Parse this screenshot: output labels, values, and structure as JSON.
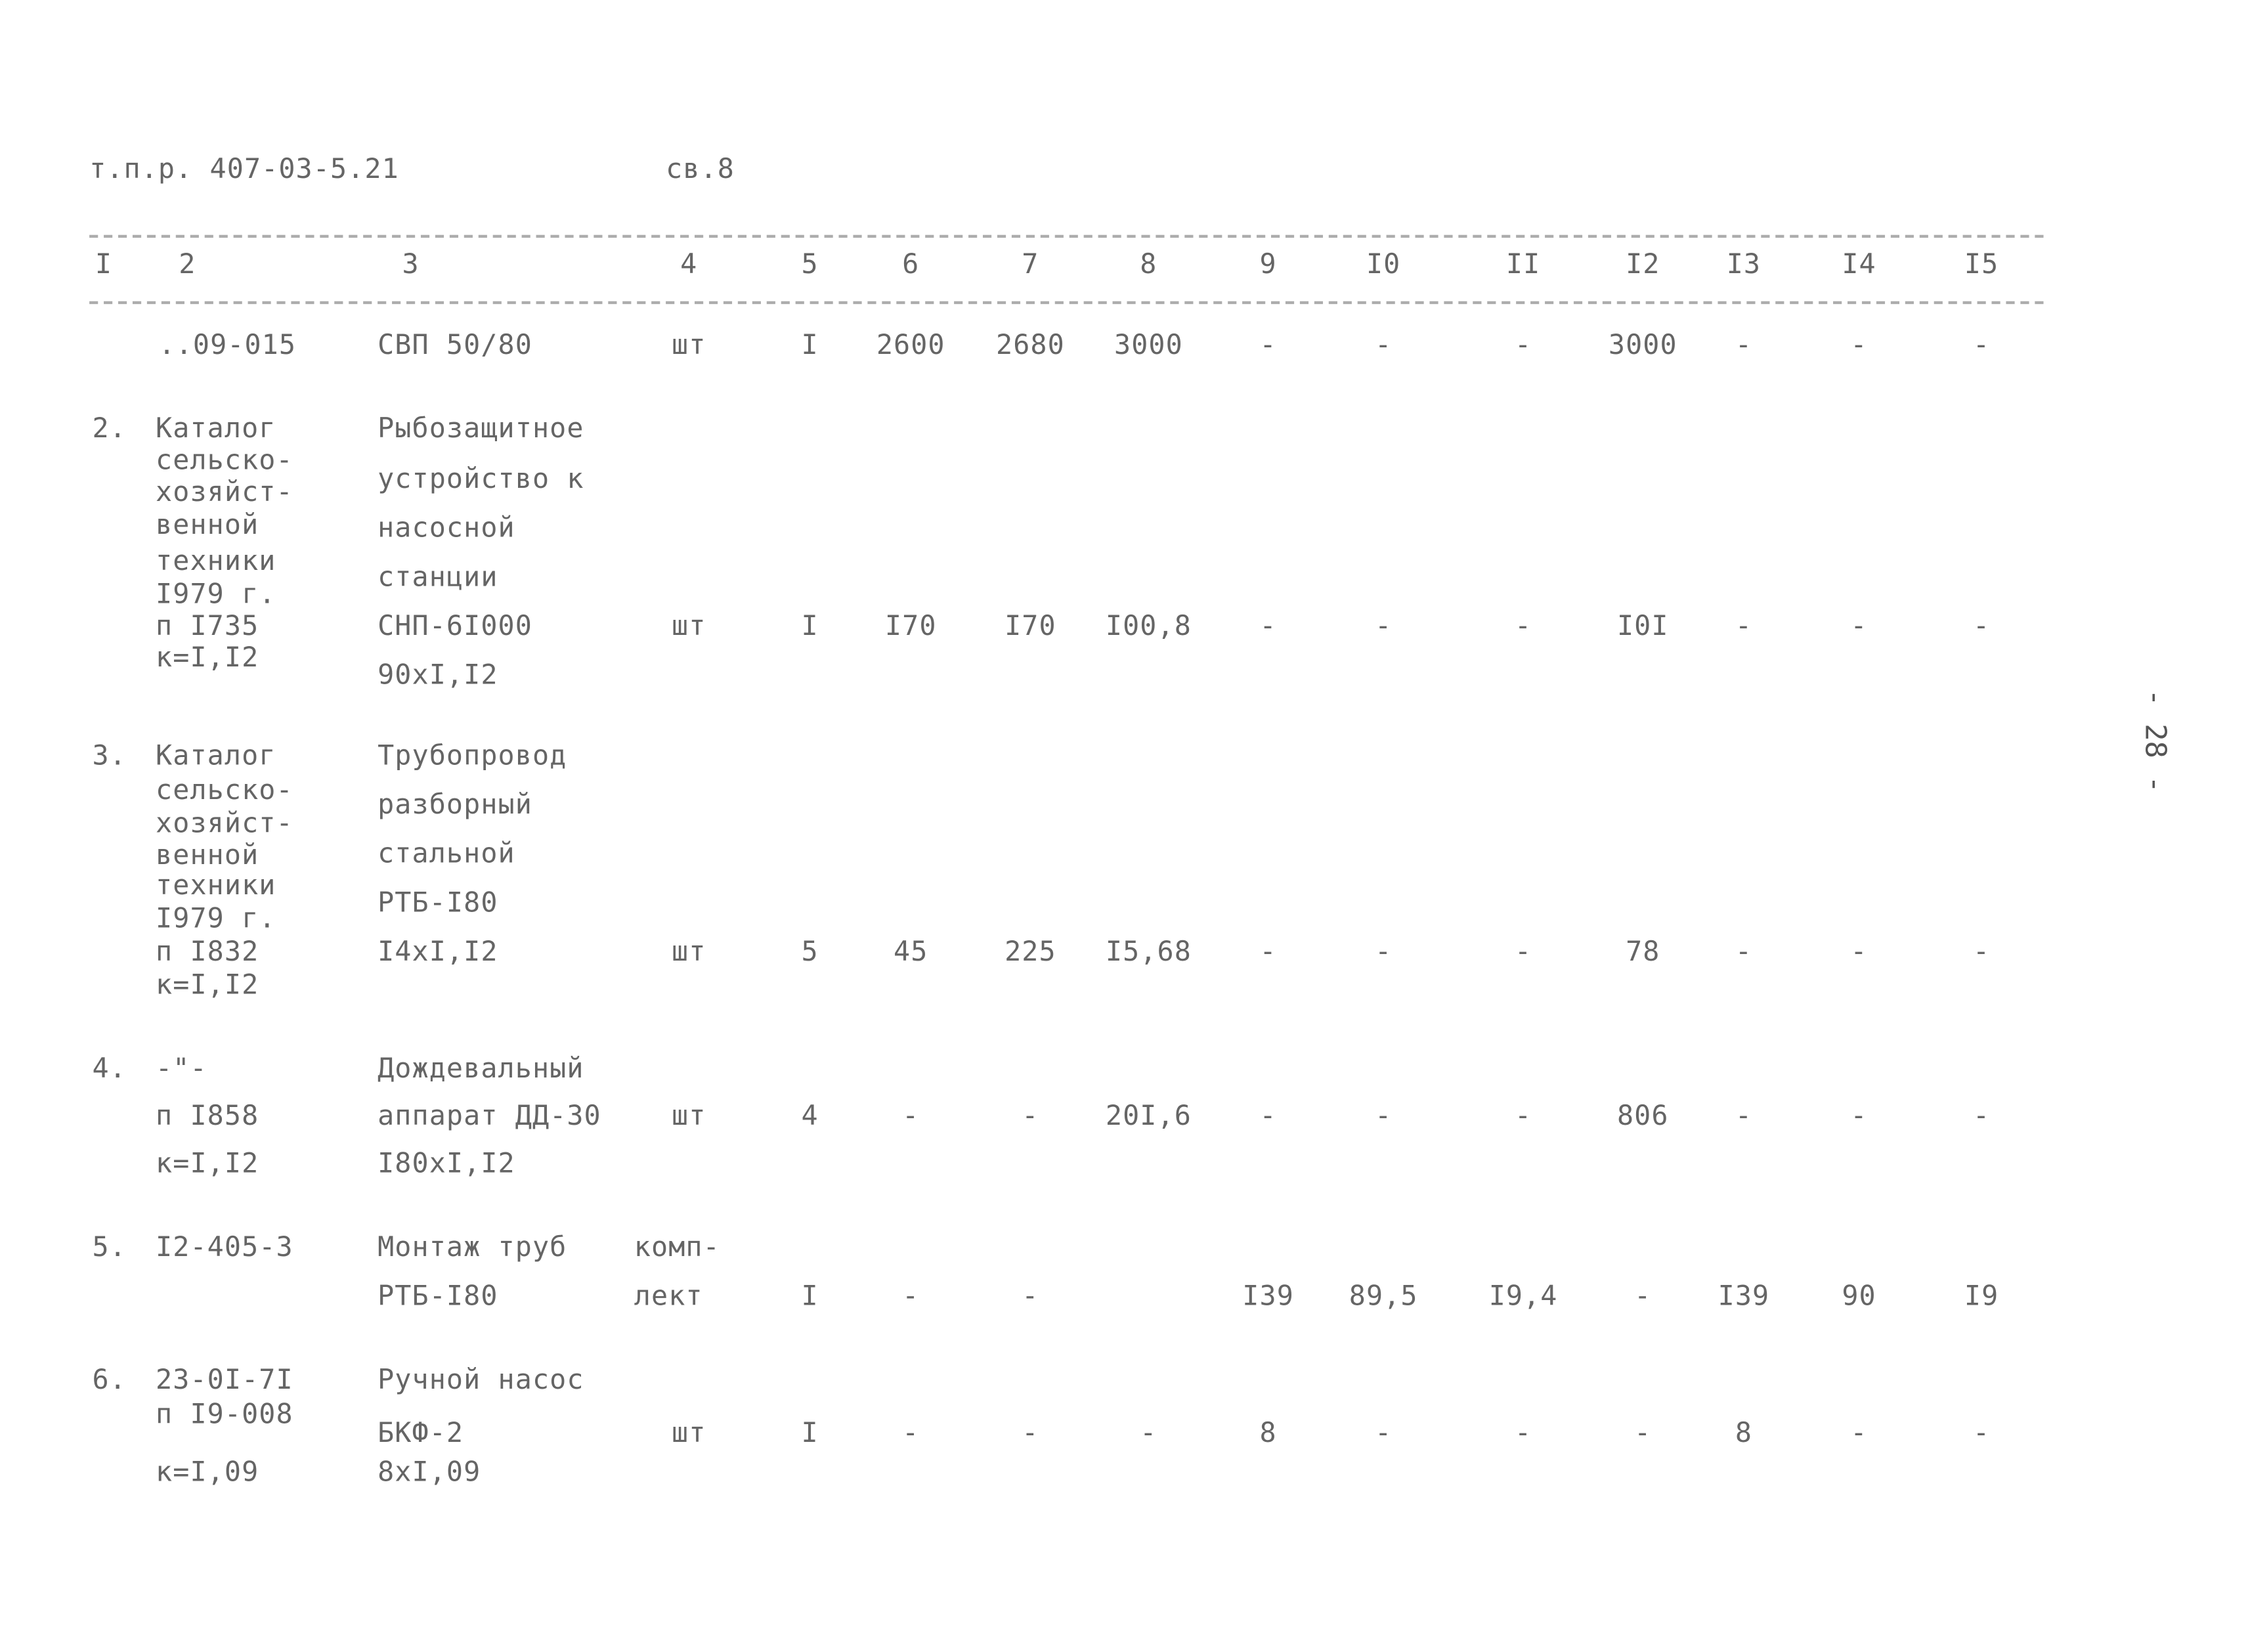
{
  "header": {
    "doc_code": "т.п.р. 407-03-5.21",
    "sheet": "св.8"
  },
  "page_number": "- 28 -",
  "column_headers": [
    "I",
    "2",
    "3",
    "4",
    "5",
    "6",
    "7",
    "8",
    "9",
    "I0",
    "II",
    "I2",
    "I3",
    "I4",
    "I5"
  ],
  "rows": [
    {
      "num": "",
      "source": [
        "..09-015"
      ],
      "name": [
        "СВП 50/80"
      ],
      "cells": [
        "шт",
        "I",
        "2600",
        "2680",
        "3000",
        "-",
        "-",
        "-",
        "3000",
        "-",
        "-",
        "-"
      ]
    },
    {
      "num": "2.",
      "source": [
        "Каталог",
        "сельско-",
        "хозяйст-",
        "венной",
        "техники",
        "I979 г.",
        "п I735",
        "к=I,I2"
      ],
      "name": [
        "Рыбозащитное",
        "устройство к",
        "насосной",
        "станции",
        "СНП-6I000",
        "90хI,I2"
      ],
      "cells": [
        "шт",
        "I",
        "I70",
        "I70",
        "I00,8",
        "-",
        "-",
        "-",
        "I0I",
        "-",
        "-",
        "-"
      ]
    },
    {
      "num": "3.",
      "source": [
        "Каталог",
        "сельско-",
        "хозяйст-",
        "венной",
        "техники",
        "I979 г.",
        "п I832",
        "к=I,I2"
      ],
      "name": [
        "Трубопровод",
        "разборный",
        "стальной",
        "РТБ-I80",
        "I4хI,I2"
      ],
      "cells": [
        "шт",
        "5",
        "45",
        "225",
        "I5,68",
        "-",
        "-",
        "-",
        "78",
        "-",
        "-",
        "-"
      ]
    },
    {
      "num": "4.",
      "source": [
        "-\"-",
        "п I858",
        "к=I,I2"
      ],
      "name": [
        "Дождевальный",
        "аппарат ДД-30",
        "I80хI,I2"
      ],
      "cells": [
        "шт",
        "4",
        "-",
        "-",
        "20I,6",
        "-",
        "-",
        "-",
        "806",
        "-",
        "-",
        "-"
      ]
    },
    {
      "num": "5.",
      "source": [
        "I2-405-3"
      ],
      "name": [
        "Монтаж труб",
        "РТБ-I80"
      ],
      "unit_lines": [
        "комп-",
        "лект"
      ],
      "cells": [
        "",
        "I",
        "-",
        "-",
        "",
        "I39",
        "89,5",
        "I9,4",
        "-",
        "I39",
        "90",
        "I9"
      ]
    },
    {
      "num": "6.",
      "source": [
        "23-0I-7I",
        "п I9-008",
        "к=I,09"
      ],
      "name": [
        "Ручной насос",
        "БКФ-2",
        "8хI,09"
      ],
      "cells": [
        "шт",
        "I",
        "-",
        "-",
        "-",
        "8",
        "-",
        "-",
        "-",
        "8",
        "-",
        "-"
      ]
    }
  ]
}
